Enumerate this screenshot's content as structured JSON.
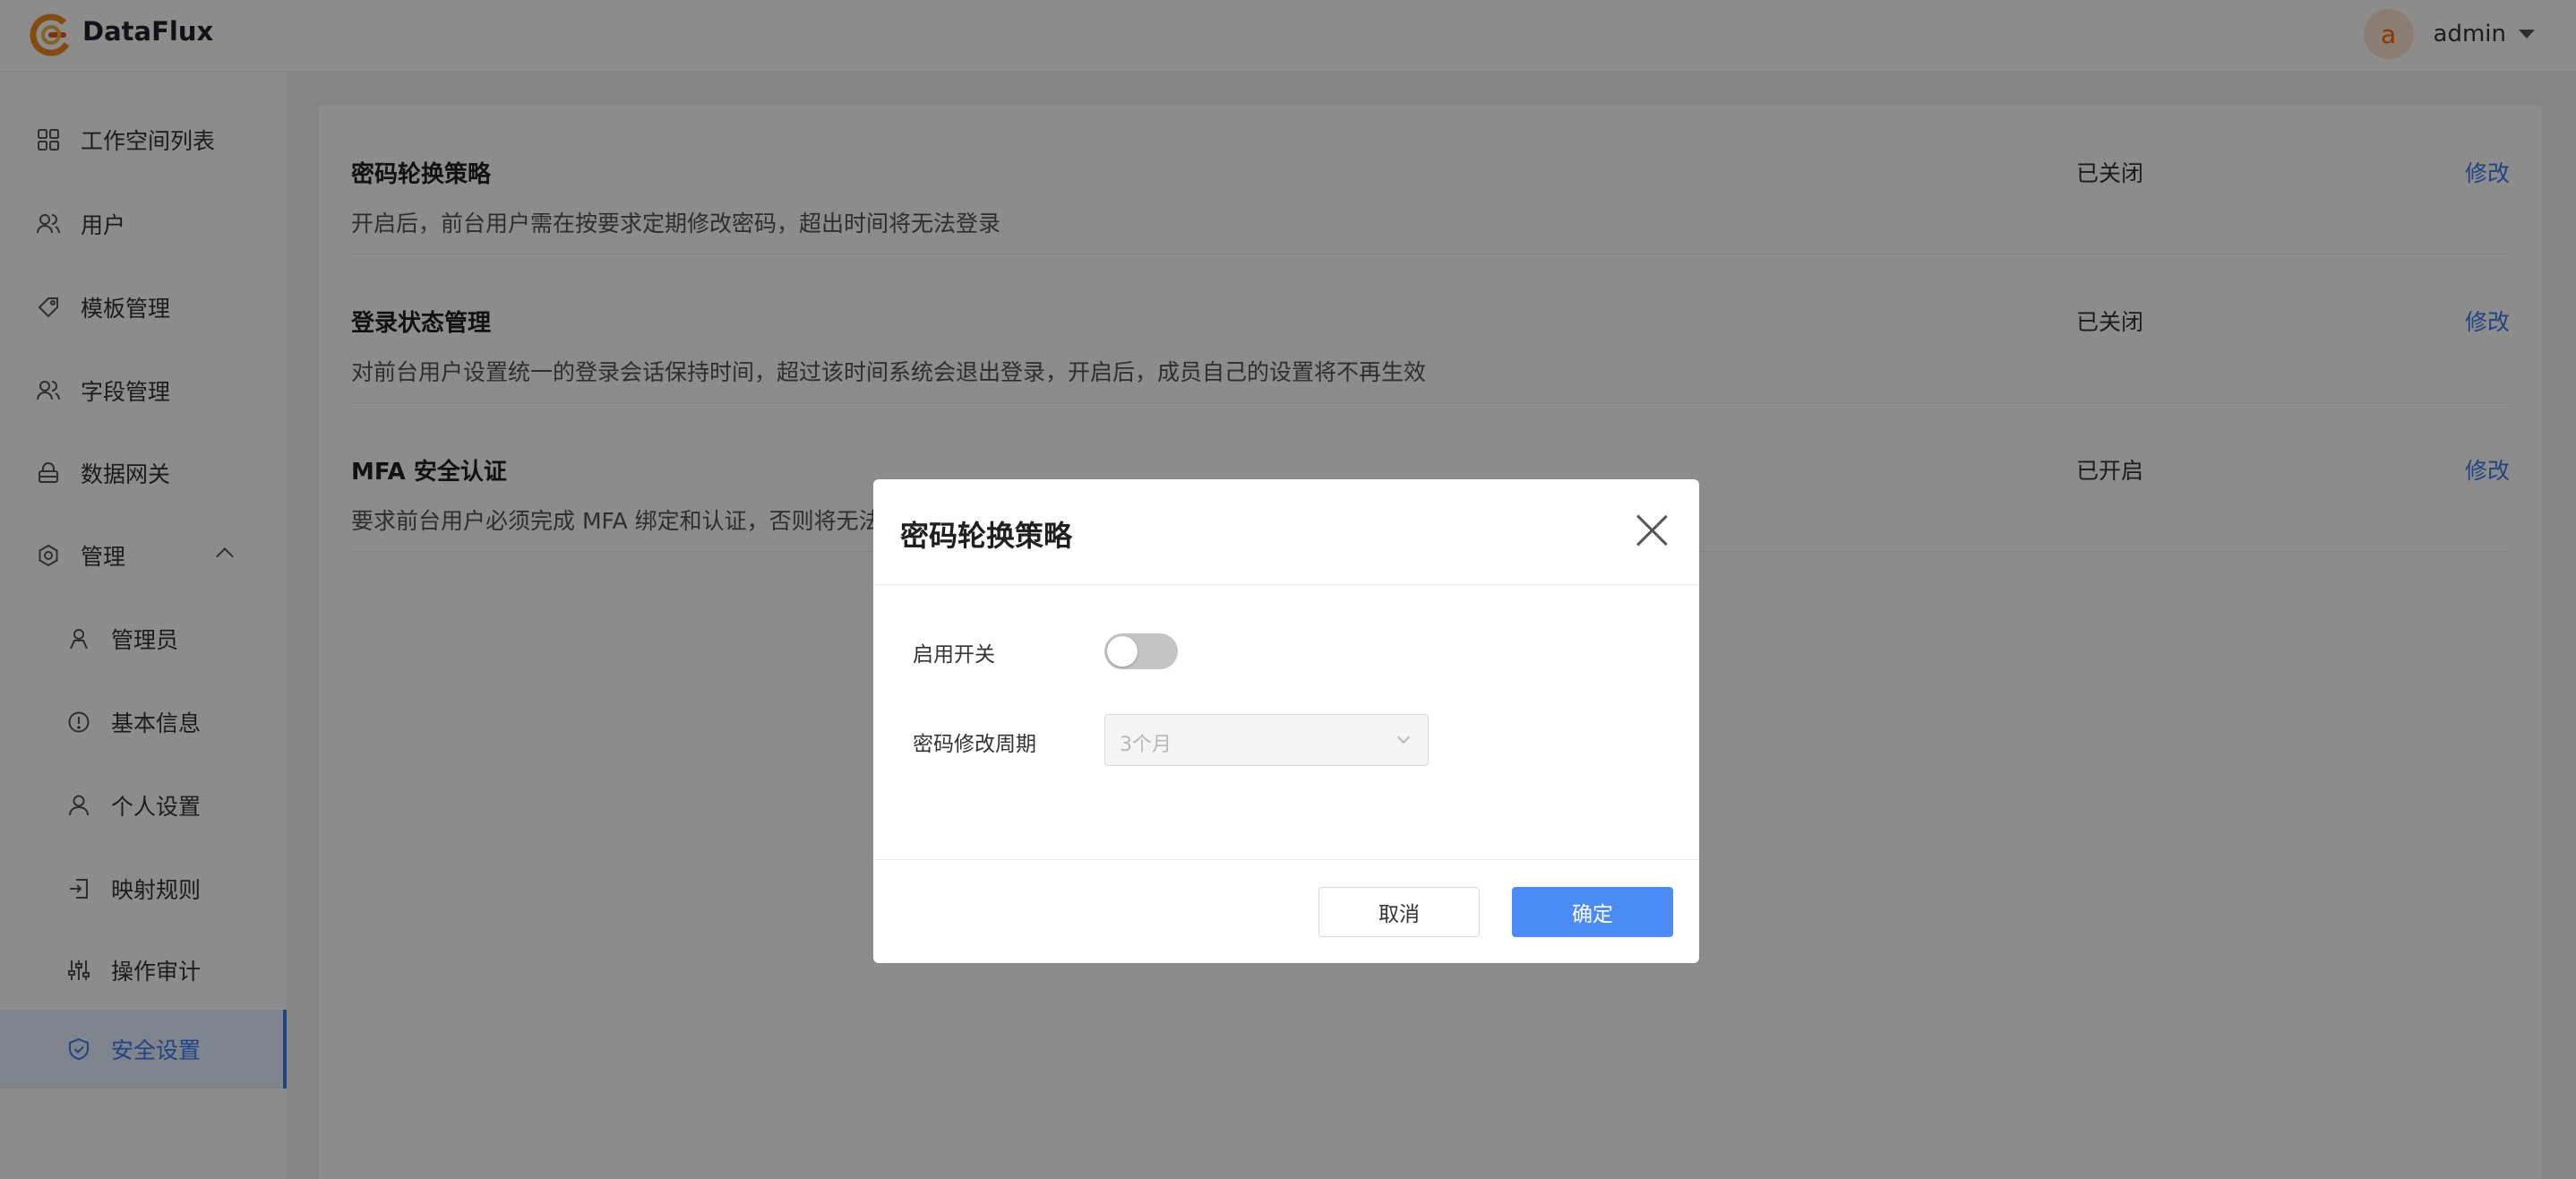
{
  "app": {
    "brand": "DataFlux"
  },
  "user": {
    "avatar_initial": "a",
    "name": "admin"
  },
  "sidebar": {
    "items": [
      {
        "label": "工作空间列表",
        "icon": "grid-icon"
      },
      {
        "label": "用户",
        "icon": "users-icon"
      },
      {
        "label": "模板管理",
        "icon": "tag-icon"
      },
      {
        "label": "字段管理",
        "icon": "users-icon"
      },
      {
        "label": "数据网关",
        "icon": "lock-icon"
      },
      {
        "label": "管理",
        "icon": "gear-icon",
        "expanded": true
      },
      {
        "label": "管理员",
        "icon": "user-icon"
      },
      {
        "label": "基本信息",
        "icon": "info-icon"
      },
      {
        "label": "个人设置",
        "icon": "user-icon"
      },
      {
        "label": "映射规则",
        "icon": "login-icon"
      },
      {
        "label": "操作审计",
        "icon": "sliders-icon"
      },
      {
        "label": "安全设置",
        "icon": "shield-icon",
        "active": true
      }
    ]
  },
  "settings": {
    "rows": [
      {
        "title": "密码轮换策略",
        "desc": "开启后，前台用户需在按要求定期修改密码，超出时间将无法登录",
        "status": "已关闭",
        "edit": "修改"
      },
      {
        "title": "登录状态管理",
        "desc": "对前台用户设置统一的登录会话保持时间，超过该时间系统会退出登录，开启后，成员自己的设置将不再生效",
        "status": "已关闭",
        "edit": "修改"
      },
      {
        "title": "MFA 安全认证",
        "desc": "要求前台用户必须完成 MFA 绑定和认证，否则将无法",
        "status": "已开启",
        "edit": "修改"
      }
    ]
  },
  "modal": {
    "title": "密码轮换策略",
    "enable_label": "启用开关",
    "enabled": false,
    "period_label": "密码修改周期",
    "period_value": "3个月",
    "cancel_label": "取消",
    "ok_label": "确定"
  },
  "colors": {
    "primary": "#4a8bf5",
    "link": "#3b7cf0",
    "active_bg": "#e6efff"
  }
}
